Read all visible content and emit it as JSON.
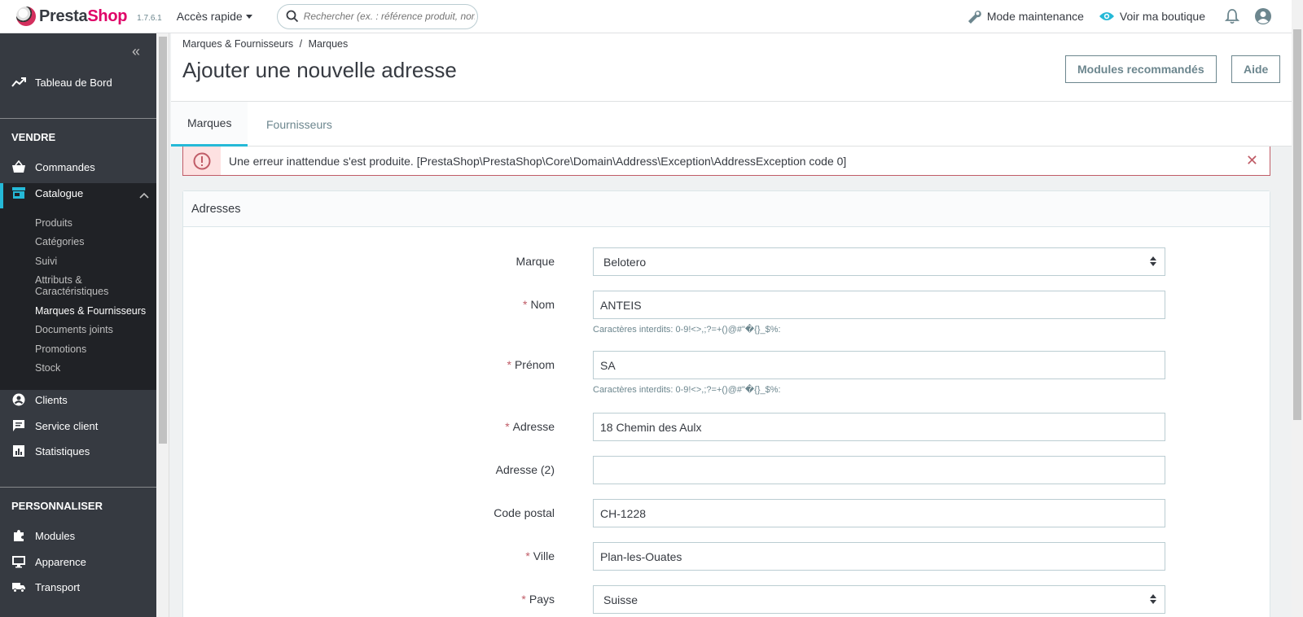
{
  "header": {
    "logo_part1": "Presta",
    "logo_part2": "Shop",
    "version": "1.7.6.1",
    "quick_access": "Accès rapide",
    "search_placeholder": "Rechercher (ex. : référence produit, nom",
    "maintenance": "Mode maintenance",
    "view_shop": "Voir ma boutique"
  },
  "sidebar": {
    "dashboard": "Tableau de Bord",
    "section_sell": "VENDRE",
    "orders": "Commandes",
    "catalog": "Catalogue",
    "catalog_items": [
      "Produits",
      "Catégories",
      "Suivi",
      "Attributs &",
      "Caractéristiques",
      "Marques & Fournisseurs",
      "Documents joints",
      "Promotions",
      "Stock"
    ],
    "customers": "Clients",
    "service": "Service client",
    "stats": "Statistiques",
    "section_custom": "PERSONNALISER",
    "modules": "Modules",
    "appearance": "Apparence",
    "shipping": "Transport"
  },
  "page": {
    "breadcrumb_1": "Marques & Fournisseurs",
    "breadcrumb_sep": "/",
    "breadcrumb_2": "Marques",
    "title": "Ajouter une nouvelle adresse",
    "btn_modules": "Modules recommandés",
    "btn_help": "Aide",
    "tab_brands": "Marques",
    "tab_suppliers": "Fournisseurs"
  },
  "alert": {
    "message": "Une erreur inattendue s'est produite. [PrestaShop\\PrestaShop\\Core\\Domain\\Address\\Exception\\AddressException code 0]"
  },
  "form": {
    "panel_title": "Adresses",
    "required_mark": "*",
    "brand_label": "Marque",
    "brand_value": "Belotero",
    "lastname_label": "Nom",
    "lastname_value": "ANTEIS",
    "firstname_label": "Prénom",
    "firstname_value": "SA",
    "forbidden_hint": "Caractères interdits: 0-9!<>,;?=+()@#\"�{}_$%:",
    "address_label": "Adresse",
    "address_value": "18 Chemin des Aulx",
    "address2_label": "Adresse (2)",
    "address2_value": "",
    "zip_label": "Code postal",
    "zip_value": "CH-1228",
    "city_label": "Ville",
    "city_value": "Plan-les-Ouates",
    "country_label": "Pays",
    "country_value": "Suisse"
  },
  "colors": {
    "accent": "#25b9d7",
    "brand_pink": "#df0067",
    "sidebar_bg": "#363a41",
    "danger": "#c05c67"
  }
}
